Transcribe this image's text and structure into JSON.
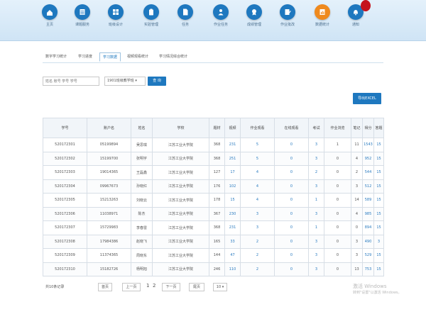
{
  "nav": [
    {
      "label": "主页",
      "icon": "home-icon",
      "accent": false
    },
    {
      "label": "课题服务",
      "icon": "list-icon",
      "accent": false
    },
    {
      "label": "班级设计",
      "icon": "grid-icon",
      "accent": false
    },
    {
      "label": "实验管理",
      "icon": "clipboard-icon",
      "accent": false
    },
    {
      "label": "任务",
      "icon": "document-icon",
      "accent": false
    },
    {
      "label": "作业任务",
      "icon": "user-icon",
      "accent": false
    },
    {
      "label": "成绩管理",
      "icon": "badge-icon",
      "accent": false
    },
    {
      "label": "作业批改",
      "icon": "edit-icon",
      "accent": false
    },
    {
      "label": "数据统计",
      "icon": "chart-icon",
      "accent": true
    },
    {
      "label": "通知",
      "icon": "bell-icon",
      "accent": false
    }
  ],
  "tabs": [
    {
      "label": "数字学习统计"
    },
    {
      "label": "学习进度"
    },
    {
      "label": "学习数据"
    },
    {
      "label": "视频观看统计"
    },
    {
      "label": "学习情况综合统计"
    }
  ],
  "search": {
    "placeholder": "姓名 账号 学号 学号"
  },
  "select": {
    "value": "1901班级教学班"
  },
  "buttons": {
    "query": "查 询",
    "export": "导出EXCEL"
  },
  "table": {
    "headers": [
      "学号",
      "账户名",
      "姓名",
      "学校",
      "题材",
      "视频",
      "作业观看",
      "在线观看",
      "考试",
      "作业浏览",
      "笔记",
      "得分",
      "答题"
    ],
    "rows": [
      [
        "520172301",
        "05199894",
        "吴思琪",
        "江苏工业大学院",
        "368",
        "231",
        "5",
        "0",
        "3",
        "1",
        "11",
        "1543",
        "15"
      ],
      [
        "520172302",
        "15199700",
        "张明宇",
        "江苏工业大学院",
        "368",
        "251",
        "5",
        "0",
        "3",
        "0",
        "4",
        "952",
        "15"
      ],
      [
        "520172303",
        "19014365",
        "王磊鑫",
        "江苏工业大学院",
        "127",
        "17",
        "4",
        "0",
        "2",
        "0",
        "2",
        "544",
        "15"
      ],
      [
        "520172304",
        "09967673",
        "孙晓红",
        "江苏工业大学院",
        "176",
        "102",
        "4",
        "0",
        "3",
        "0",
        "3",
        "512",
        "15"
      ],
      [
        "520172305",
        "15213263",
        "刘晓云",
        "江苏工业大学院",
        "178",
        "15",
        "4",
        "0",
        "1",
        "0",
        "14",
        "589",
        "15"
      ],
      [
        "520172306",
        "11038971",
        "陈杰",
        "江苏工业大学院",
        "367",
        "230",
        "3",
        "0",
        "3",
        "0",
        "4",
        "985",
        "15"
      ],
      [
        "520172307",
        "15729983",
        "李春雷",
        "江苏工业大学院",
        "368",
        "231",
        "3",
        "0",
        "1",
        "0",
        "0",
        "894",
        "15"
      ],
      [
        "520172308",
        "17984386",
        "赵晓飞",
        "江苏工业大学院",
        "165",
        "33",
        "2",
        "0",
        "3",
        "0",
        "3",
        "490",
        "3"
      ],
      [
        "520172309",
        "11374365",
        "周晓东",
        "江苏工业大学院",
        "144",
        "47",
        "2",
        "0",
        "3",
        "0",
        "3",
        "529",
        "15"
      ],
      [
        "520172310",
        "15182726",
        "杨明旭",
        "江苏工业大学院",
        "246",
        "110",
        "2",
        "0",
        "3",
        "0",
        "13",
        "753",
        "15"
      ]
    ]
  },
  "pager": {
    "summary": "共10条记录",
    "first": "首页",
    "prev": "上一页",
    "page_current": "1",
    "page_next": "2",
    "next": "下一页",
    "last": "尾页",
    "page_size": "10 ▾"
  },
  "watermark": {
    "line1": "激活 Windows",
    "line2": "转到\"设置\"以激活 Windows。"
  }
}
